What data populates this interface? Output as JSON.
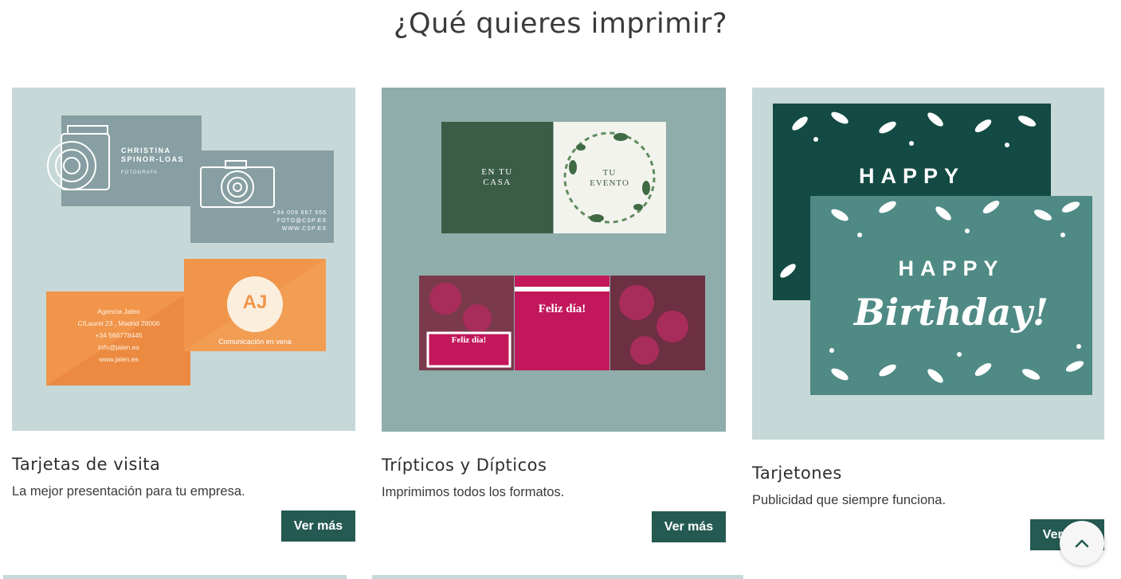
{
  "header": {
    "title": "¿Qué quieres imprimir?"
  },
  "cards": [
    {
      "title": "Tarjetas de visita",
      "description": "La mejor presentación para tu empresa.",
      "button_label": "Ver más",
      "image_text": {
        "name": "CHRISTINA SPINOR-LOAS",
        "role": "FOTOGRAFA",
        "phone": "+34 009 667 555",
        "email": "FOTO@CSP.ES",
        "web": "WWW.CSP.ES",
        "agency": "Agencia Jaleo",
        "address": "C/Laurel 23 , Madrid 28006",
        "agency_phone": "+34 566778445",
        "agency_email": "info@jalen.es",
        "agency_web": "www.jalen.es",
        "logo": "AJ",
        "tagline": "Comunicación en vena"
      }
    },
    {
      "title": "Trípticos y Dípticos",
      "description": "Imprimimos todos los formatos.",
      "button_label": "Ver más",
      "image_text": {
        "cover_line1": "EN TU",
        "cover_line2": "CASA",
        "event_line1": "TU",
        "event_line2": "EVENTO",
        "greeting_big": "Feliz día!",
        "greeting_small": "Feliz día!"
      }
    },
    {
      "title": "Tarjetones",
      "description": "Publicidad que siempre funciona.",
      "button_label": "Ver más",
      "image_text": {
        "back_word": "HAPPY",
        "front_word": "HAPPY",
        "script_word": "Birthday!"
      }
    }
  ],
  "colors": {
    "button": "#245a52",
    "card1_bg": "#c6d8d7",
    "card2_bg": "#8fadab",
    "card3_bg": "#c6d8d7",
    "dark_green": "#134a44",
    "teal": "#4f8a85",
    "orange": "#f0954a",
    "magenta": "#c2185b"
  },
  "icons": {
    "scroll_top": "chevron-up-icon"
  }
}
